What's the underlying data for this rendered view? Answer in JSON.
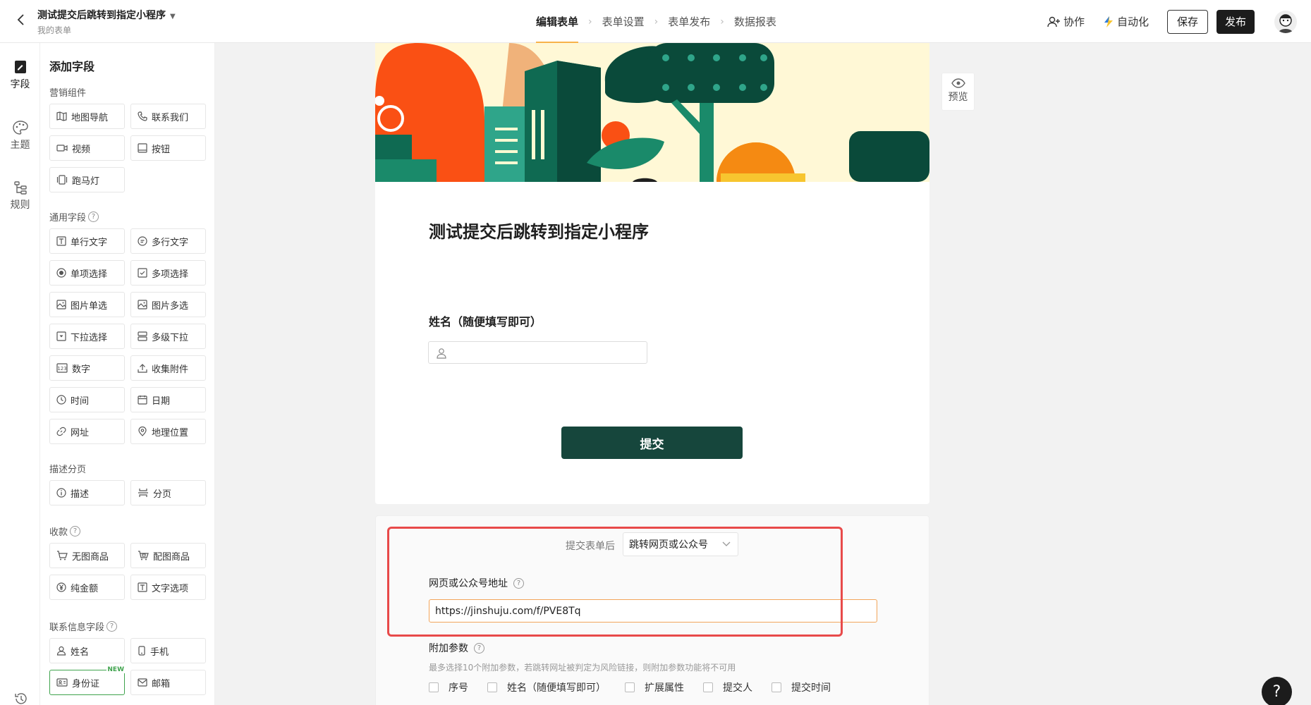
{
  "header": {
    "form_title": "测试提交后跳转到指定小程序",
    "form_subtitle": "我的表单",
    "steps": [
      "编辑表单",
      "表单设置",
      "表单发布",
      "数据报表"
    ],
    "collab_label": "协作",
    "automation_label": "自动化",
    "save_label": "保存",
    "publish_label": "发布"
  },
  "rail": {
    "items": [
      "字段",
      "主题",
      "规则"
    ]
  },
  "panel": {
    "title": "添加字段",
    "groups": {
      "marketing": {
        "label": "营销组件",
        "items": [
          "地图导航",
          "联系我们",
          "视频",
          "按钮",
          "跑马灯"
        ]
      },
      "general": {
        "label": "通用字段",
        "items": [
          "单行文字",
          "多行文字",
          "单项选择",
          "多项选择",
          "图片单选",
          "图片多选",
          "下拉选择",
          "多级下拉",
          "数字",
          "收集附件",
          "时间",
          "日期",
          "网址",
          "地理位置"
        ]
      },
      "desc": {
        "label": "描述分页",
        "items": [
          "描述",
          "分页"
        ]
      },
      "payment": {
        "label": "收款",
        "items": [
          "无图商品",
          "配图商品",
          "纯金额",
          "文字选项"
        ]
      },
      "contact": {
        "label": "联系信息字段",
        "items": [
          "姓名",
          "手机",
          "身份证",
          "邮箱"
        ],
        "new_tag": "NEW"
      }
    }
  },
  "form": {
    "heading": "测试提交后跳转到指定小程序",
    "question_label": "姓名（随便填写即可）",
    "submit_label": "提交"
  },
  "after_submit": {
    "label": "提交表单后",
    "selected": "跳转网页或公众号",
    "url_label": "网页或公众号地址",
    "url_value": "https://jinshuju.com/f/PVE8Tq",
    "param_label": "附加参数",
    "param_hint": "最多选择10个附加参数，若跳转网址被判定为风险链接，则附加参数功能将不可用",
    "params": [
      "序号",
      "姓名（随便填写即可）",
      "扩展属性",
      "提交人",
      "提交时间"
    ]
  },
  "preview_label": "预览",
  "help_label": "?",
  "colors": {
    "accent": "#f7b24a",
    "submit": "#16463c",
    "highlight_box": "#e84a4a"
  }
}
